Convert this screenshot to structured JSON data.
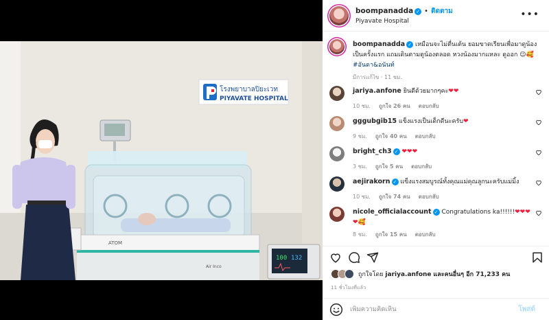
{
  "post": {
    "username": "boompanadda",
    "follow_label": "ติดตาม",
    "location": "Piyavate Hospital",
    "photo": {
      "sign_thai": "โรงพยาบาลปิยะเวท",
      "sign_english": "PIYAVATE HOSPITAL",
      "incubator_brand": "ATOM",
      "incubator_model": "Air Inco",
      "monitor_value_1": "100",
      "monitor_value_2": "132"
    },
    "caption": {
      "username": "boompanadda",
      "text": "เหมือนจะไม่ตื่นเต้น ยอมขาดเรียนเพื่อมาดูน้องเป็นครั้งแรก แถมเดินตามดูน้องตลอด หวงน้องมากแหละ ดูออก 😉🥰",
      "hashtag": "#อันดา&อนันท์",
      "meta": "มีการแก้ไข · 11 ชม."
    },
    "comments": [
      {
        "username": "jariya.anfone",
        "verified": false,
        "text": "ยินดีด้วยมากๆคะ",
        "hearts": "❤❤",
        "time": "10 ชม.",
        "likes": "ถูกใจ 26 คน",
        "reply": "ตอบกลับ"
      },
      {
        "username": "gggubgib15",
        "verified": false,
        "text": "แข็งแรงเป็นเด็กดีนะครับ",
        "hearts": "❤",
        "time": "9 ชม.",
        "likes": "ถูกใจ 40 คน",
        "reply": "ตอบกลับ"
      },
      {
        "username": "bright_ch3",
        "verified": true,
        "text": "",
        "hearts": "❤❤❤",
        "time": "3 ชม.",
        "likes": "ถูกใจ 5 คน",
        "reply": "ตอบกลับ"
      },
      {
        "username": "aejirakorn",
        "verified": true,
        "text": "แข็งแรงสมบูรณ์ทั้งคุณแม่คุณลูกนะครับแม่มิ้ง",
        "hearts": "",
        "time": "10 ชม.",
        "likes": "ถูกใจ 74 คน",
        "reply": "ตอบกลับ"
      },
      {
        "username": "nicole_officialaccount",
        "verified": true,
        "text": "Congratulations ka!!!!!!",
        "hearts": "❤❤❤",
        "extra": "❤🥰",
        "time": "8 ชม.",
        "likes": "ถูกใจ 15 คน",
        "reply": "ตอบกลับ"
      }
    ],
    "liked_by_prefix": "ถูกใจโดย",
    "liked_by_user": "jariya.anfone",
    "liked_by_suffix": "และคนอื่นๆ อีก 71,233 คน",
    "timestamp": "11 ชั่วโมงที่แล้ว",
    "add_comment_placeholder": "เพิ่มความคิดเห็น",
    "post_label": "โพสต์",
    "colors": {
      "accent": "#0095f6",
      "heart": "#ed1c3a",
      "muted": "#8e8e8e"
    }
  }
}
